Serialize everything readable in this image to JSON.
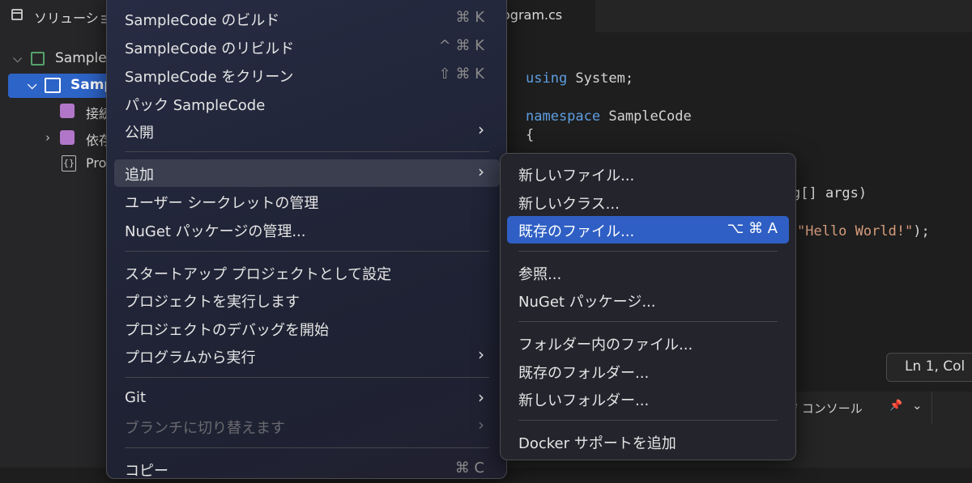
{
  "sidebar": {
    "title": "ソリューショ",
    "tree": [
      {
        "label": "Sample"
      },
      {
        "label": "Samp"
      },
      {
        "label": "接続"
      },
      {
        "label": "依存"
      },
      {
        "label": "Pro"
      }
    ]
  },
  "editor": {
    "tab_label": "ogram.cs",
    "code": {
      "l1_kw": "using",
      "l1_rest": " System;",
      "l2_kw": "namespace",
      "l2_rest": " SampleCode",
      "l3": "{",
      "l4_partial": "g[] args)",
      "l5_str": "\"Hello World!\"",
      "l5_end": ");"
    },
    "status": "Ln 1, Col",
    "console_label": "ジ コンソール"
  },
  "context_menu": {
    "items": [
      {
        "label": "SampleCode のビルド",
        "shortcut": "⌘ K"
      },
      {
        "label": "SampleCode のリビルド",
        "shortcut": "^ ⌘ K"
      },
      {
        "label": "SampleCode をクリーン",
        "shortcut": "⇧ ⌘ K"
      },
      {
        "label": "パック SampleCode"
      },
      {
        "label": "公開"
      },
      {
        "label": "追加"
      },
      {
        "label": "ユーザー シークレットの管理"
      },
      {
        "label": "NuGet パッケージの管理..."
      },
      {
        "label": "スタートアップ プロジェクトとして設定"
      },
      {
        "label": "プロジェクトを実行します"
      },
      {
        "label": "プロジェクトのデバッグを開始"
      },
      {
        "label": "プログラムから実行"
      },
      {
        "label": "Git"
      },
      {
        "label": "ブランチに切り替えます"
      },
      {
        "label": "コピー",
        "shortcut": "⌘ C"
      }
    ]
  },
  "submenu": {
    "items": [
      {
        "label": "新しいファイル..."
      },
      {
        "label": "新しいクラス..."
      },
      {
        "label": "既存のファイル...",
        "shortcut": "⌥ ⌘ A"
      },
      {
        "label": "参照..."
      },
      {
        "label": "NuGet パッケージ..."
      },
      {
        "label": "フォルダー内のファイル..."
      },
      {
        "label": "既存のフォルダー..."
      },
      {
        "label": "新しいフォルダー..."
      },
      {
        "label": "Docker サポートを追加"
      }
    ]
  },
  "icons": {
    "submenu_arrow": "chevron-right-icon",
    "tree_expanded": "chevron-down-icon",
    "tree_collapsed": "chevron-right-icon"
  },
  "colors": {
    "selection": "#2f5fc4",
    "keyword": "#5e9fe1",
    "string": "#d69d7d",
    "solution_icon": "#55a26b",
    "folder_icon": "#b276c9"
  }
}
